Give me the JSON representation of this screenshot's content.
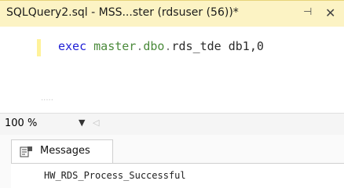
{
  "tab": {
    "title": "SQLQuery2.sql - MSS...ster (rdsuser (56))*",
    "pin_icon": "pin-icon",
    "close_icon": "close-icon"
  },
  "editor": {
    "keyword": "exec",
    "object_master": "master",
    "dot1": ".",
    "schema": "dbo",
    "dot2": ".",
    "procedure": "rds_tde",
    "args": " db1,0"
  },
  "status": {
    "zoom": "100 %",
    "zoom_dropdown_icon": "chevron-down-icon"
  },
  "results": {
    "tab_label": "Messages",
    "message": "HW_RDS_Process_Successful"
  },
  "colors": {
    "tab_bg": "#fcf3c4",
    "keyword": "#1f1fd6",
    "system_object": "#4a8a3a"
  }
}
